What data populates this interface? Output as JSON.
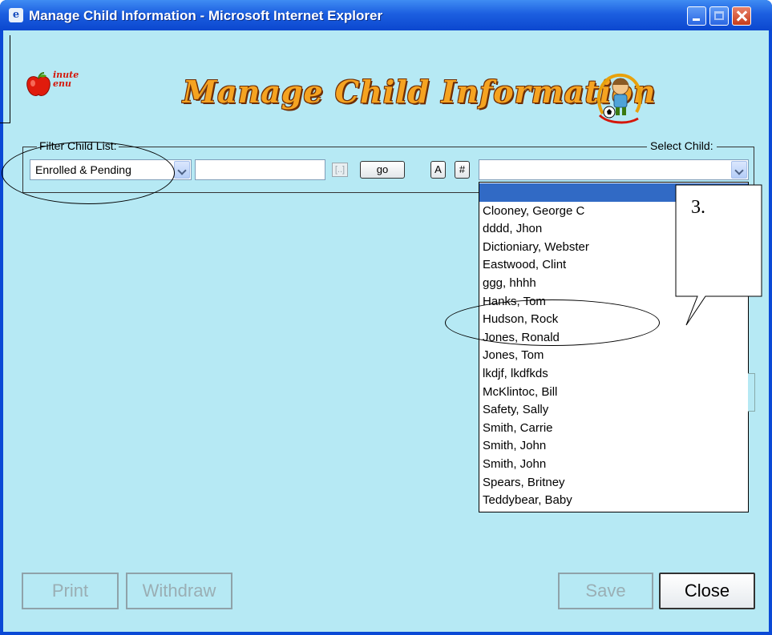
{
  "window": {
    "title": "Manage Child Information - Microsoft Internet Explorer"
  },
  "header": {
    "logo_text_line1": "inute",
    "logo_text_line2": "enu",
    "title": "Manage Child Information"
  },
  "filter": {
    "legend": "Filter Child List:",
    "status_value": "Enrolled & Pending",
    "search_value": "",
    "browse_label": "[..]",
    "go_label": "go",
    "alpha_label": "A",
    "number_label": "#"
  },
  "select_child": {
    "legend": "Select Child:",
    "value": "",
    "options": [
      "",
      "Clooney, George C",
      "dddd, Jhon",
      "Dictioniary, Webster",
      "Eastwood, Clint",
      "ggg, hhhh",
      "Hanks, Tom",
      "Hudson, Rock",
      "Jones, Ronald",
      "Jones, Tom",
      "lkdjf, lkdfkds",
      "McKlintoc, Bill",
      "Safety, Sally",
      "Smith, Carrie",
      "Smith, John",
      "Smith, John",
      "Spears, Britney",
      "Teddybear, Baby"
    ],
    "selected_index": 0
  },
  "callout": {
    "text": "3."
  },
  "buttons": {
    "print": "Print",
    "withdraw": "Withdraw",
    "save": "Save",
    "close": "Close"
  },
  "colors": {
    "client_bg": "#b6e9f4",
    "titlebar": "#1c5fe0",
    "selection": "#316ac5"
  }
}
